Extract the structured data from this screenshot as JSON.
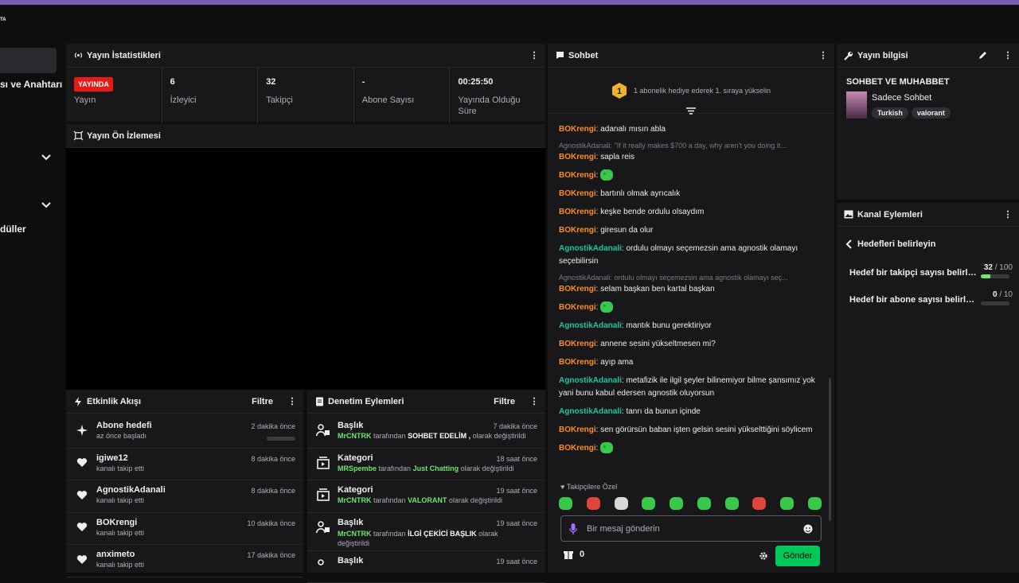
{
  "app": {
    "logo_text": "TA"
  },
  "left_nav": {
    "item1": "sı ve Anahtarı",
    "item2": "düller"
  },
  "stats": {
    "title": "Yayın İstatistikleri",
    "live_badge": "YAYINDA",
    "items": [
      {
        "value": "",
        "label": "Yayın"
      },
      {
        "value": "6",
        "label": "İzleyici"
      },
      {
        "value": "32",
        "label": "Takipçi"
      },
      {
        "value": "-",
        "label": "Abone Sayısı"
      },
      {
        "value": "00:25:50",
        "label": "Yayında Olduğu Süre"
      }
    ]
  },
  "preview": {
    "title": "Yayın Ön İzlemesi"
  },
  "activity": {
    "title": "Etkinlik Akışı",
    "filter": "Filtre",
    "items": [
      {
        "title": "Abone hedefi",
        "sub": "az önce başladı",
        "time": "2 dakika önce",
        "icon": "sparkle-icon"
      },
      {
        "title": "igiwe12",
        "sub": "kanalı takip etti",
        "time": "8 dakika önce",
        "icon": "heart-icon"
      },
      {
        "title": "AgnostikAdanali",
        "sub": "kanalı takip etti",
        "time": "8 dakika önce",
        "icon": "heart-icon"
      },
      {
        "title": "BOKrengi",
        "sub": "kanalı takip etti",
        "time": "10 dakika önce",
        "icon": "heart-icon"
      },
      {
        "title": "anximeto",
        "sub": "kanalı takip etti",
        "time": "17 dakika önce",
        "icon": "heart-icon"
      }
    ]
  },
  "moderation": {
    "title": "Denetim Eylemleri",
    "filter": "Filtre",
    "items": [
      {
        "title": "Başlık",
        "user": "MrCNTRK",
        "mid": "tarafından",
        "value": "SOHBET EDELİM ,",
        "end": "olarak değiştirildi",
        "time": "7 dakika önce"
      },
      {
        "title": "Kategori",
        "user": "MRSpembe",
        "mid": "tarafından",
        "value": "Just Chatting",
        "end": "olarak değiştirildi",
        "time": "18 saat önce"
      },
      {
        "title": "Kategori",
        "user": "MrCNTRK",
        "mid": "tarafından",
        "value": "VALORANT",
        "end": "olarak değiştirildi",
        "time": "19 saat önce"
      },
      {
        "title": "Başlık",
        "user": "MrCNTRK",
        "mid": "tarafından",
        "value": "İLGİ ÇEKİCİ BAŞLIK",
        "end": "olarak değiştirildi",
        "time": "19 saat önce"
      },
      {
        "title": "Başlık",
        "user": "",
        "mid": "",
        "value": "",
        "end": "",
        "time": "19 saat önce"
      }
    ]
  },
  "chat": {
    "title": "Sohbet",
    "pinned_rank": "1",
    "pinned": "1 abonelik hediye ederek 1. sıraya yükselin",
    "messages": [
      {
        "user": "BOKrengi",
        "text": "adanalı mısın abla",
        "reply": "",
        "emote": false,
        "c": 1
      },
      {
        "user": "BOKrengi",
        "text": "sapla reis",
        "reply": "AgnostikAdanali: \"If it really makes $700 a day, why aren't you doing it...",
        "emote": false,
        "c": 1
      },
      {
        "user": "BOKrengi",
        "text": "",
        "reply": "",
        "emote": true,
        "c": 1
      },
      {
        "user": "BOKrengi",
        "text": "bartınlı olmak ayrıcalık",
        "reply": "",
        "emote": false,
        "c": 1
      },
      {
        "user": "BOKrengi",
        "text": "keşke bende ordulu olsaydım",
        "reply": "",
        "emote": false,
        "c": 1
      },
      {
        "user": "BOKrengi",
        "text": "giresun da olur",
        "reply": "",
        "emote": false,
        "c": 1
      },
      {
        "user": "AgnostikAdanali",
        "text": "ordulu olmayı seçemezsin ama agnostik olamayı seçebilirsin",
        "reply": "",
        "emote": false,
        "c": 2
      },
      {
        "user": "BOKrengi",
        "text": "selam başkan ben kartal başkan",
        "reply": "AgnostikAdanali: ordulu olmayı seçemezsin ama agnostik olamayı seç...",
        "emote": false,
        "c": 1
      },
      {
        "user": "BOKrengi",
        "text": "",
        "reply": "",
        "emote": true,
        "c": 1
      },
      {
        "user": "AgnostikAdanali",
        "text": "mantık bunu gerektiriyor",
        "reply": "",
        "emote": false,
        "c": 2
      },
      {
        "user": "BOKrengi",
        "text": "annene sesini yükseltmesen mi?",
        "reply": "",
        "emote": false,
        "c": 1
      },
      {
        "user": "BOKrengi",
        "text": "ayıp ama",
        "reply": "",
        "emote": false,
        "c": 1
      },
      {
        "user": "AgnostikAdanali",
        "text": "metafizik ile ilgil şeyler bilinemiyor bilme şansımız yok yani bunu kabul edersen agnostik oluyorsun",
        "reply": "",
        "emote": false,
        "c": 2
      },
      {
        "user": "AgnostikAdanali",
        "text": "tanrı da bunun içinde",
        "reply": "",
        "emote": false,
        "c": 2
      },
      {
        "user": "BOKrengi",
        "text": "sen görürsün baban işten gelsin sesini yükselttiğini söylicem",
        "reply": "",
        "emote": false,
        "c": 1
      },
      {
        "user": "BOKrengi",
        "text": "",
        "reply": "",
        "emote": true,
        "c": 1
      }
    ],
    "followers_only": "Takipçilere Özel",
    "input_placeholder": "Bir mesaj gönderin",
    "points": "0",
    "send": "Gönder"
  },
  "info": {
    "title": "Yayın bilgisi",
    "stream_title": "SOHBET VE MUHABBET",
    "category": "Sadece Sohbet",
    "tags": [
      "Turkish",
      "valorant"
    ]
  },
  "channel_actions": {
    "title": "Kanal Eylemleri",
    "back": "Hedefleri belirleyin",
    "goals": [
      {
        "label": "Hedef bir takipçi sayısı belirleyin",
        "current": "32",
        "target": "/ 100",
        "progress": 0.32
      },
      {
        "label": "Hedef bir abone sayısı belirleyin",
        "current": "0",
        "target": "/ 10",
        "progress": 0
      }
    ]
  },
  "colors": {
    "accent": "#7b5cb3",
    "live": "#e91916",
    "send": "#00c95a",
    "user_orange": "#ff8c28",
    "user_teal": "#22c4a0"
  }
}
